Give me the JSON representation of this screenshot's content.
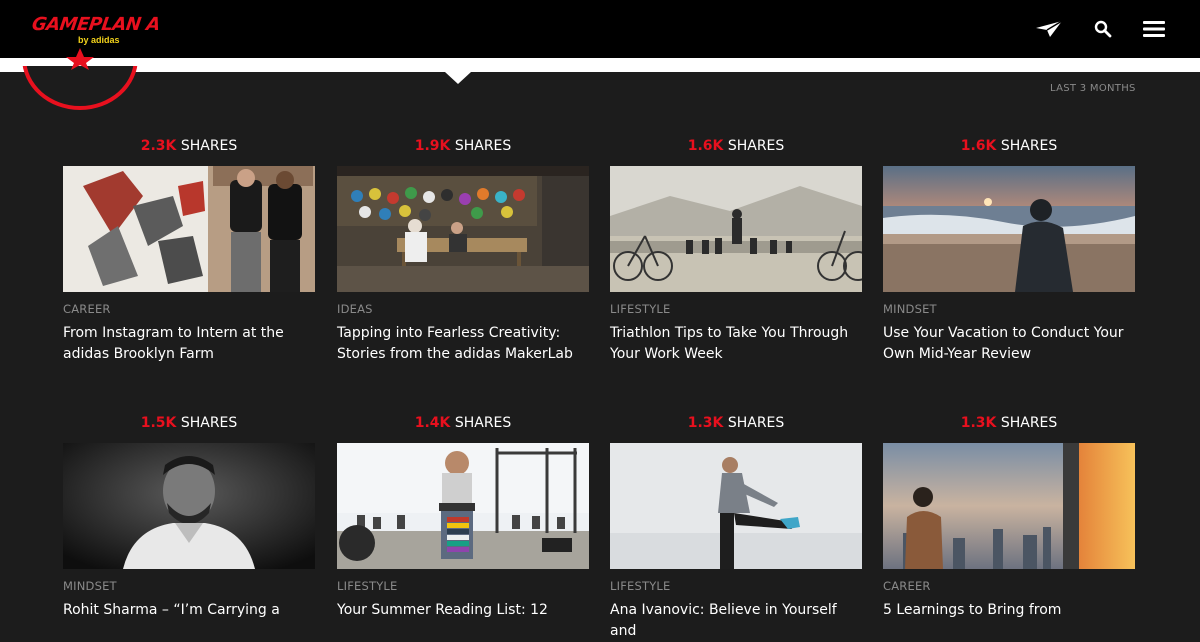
{
  "brand": {
    "name": "GAMEPLAN A",
    "sub": "by adidas"
  },
  "header_icons": [
    "paper-plane-icon",
    "search-icon",
    "hamburger-menu-icon"
  ],
  "period": "LAST 3 MONTHS",
  "shares_label": "SHARES",
  "colors": {
    "accent": "#e8101e",
    "logo_sub": "#f2d21b",
    "header_bg": "#000000",
    "page_bg": "#1c1c1c"
  },
  "cards": [
    {
      "shares": "2.3K",
      "category": "CAREER",
      "title": "From Instagram to Intern at the adidas Brooklyn Farm"
    },
    {
      "shares": "1.9K",
      "category": "IDEAS",
      "title": "Tapping into Fearless Creativity: Stories from the adidas MakerLab"
    },
    {
      "shares": "1.6K",
      "category": "LIFESTYLE",
      "title": "Triathlon Tips to Take You Through Your Work Week"
    },
    {
      "shares": "1.6K",
      "category": "MINDSET",
      "title": "Use Your Vacation to Conduct Your Own Mid-Year Review"
    },
    {
      "shares": "1.5K",
      "category": "MINDSET",
      "title": "Rohit Sharma – “I’m Carrying a"
    },
    {
      "shares": "1.4K",
      "category": "LIFESTYLE",
      "title": "Your Summer Reading List: 12"
    },
    {
      "shares": "1.3K",
      "category": "LIFESTYLE",
      "title": "Ana Ivanovic: Believe in Yourself and"
    },
    {
      "shares": "1.3K",
      "category": "CAREER",
      "title": "5 Learnings to Bring from"
    }
  ]
}
